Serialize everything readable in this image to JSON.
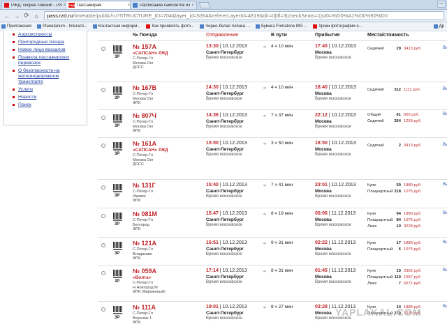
{
  "browser": {
    "tabs": [
      {
        "label": "РЖД: скорее совсем! - РЖД",
        "close": "×",
        "active": false
      },
      {
        "label": "Пассажирам",
        "close": "×",
        "active": true
      },
      {
        "label": "Расписание самолётов из С",
        "close": "×",
        "active": false
      }
    ],
    "win_button": "—",
    "url_domain": "pass.rzd.ru",
    "url_path": "/timetable/public/ru?STRUCTURE_ID=704&layer_id=5354&refererLayerId=4819&dir=0|tfl=3|checkSeats=1|st0=%D0%A1%D0%90%D0",
    "nav": {
      "back": "←",
      "forward": "→",
      "reload": "⟳",
      "home": "⌂"
    },
    "bookmarks": [
      {
        "label": "Приложения"
      },
      {
        "label": "Planetarium - Interacti..."
      },
      {
        "label": "Контактная информ..."
      },
      {
        "label": "Как проявлять фото..."
      },
      {
        "label": "Черно-белая плёнка ..."
      },
      {
        "label": "Бумага Fomatone MG ..."
      },
      {
        "label": "Уроки фотографии о..."
      }
    ],
    "bookmarks_other": "Др"
  },
  "sidebar": {
    "items": [
      "Аэроэкспрессы",
      "Пригородные поезда",
      "Новое лицо вокзалов",
      "Правила пассажирских перевозок",
      "О безопасности на железнодорожном транспорте",
      "Услуги",
      "Новости",
      "Поиск"
    ]
  },
  "table": {
    "headers": {
      "train": "№ Поезда",
      "departure": "Отправление",
      "duration": "В пути",
      "arrival": "Прибытие",
      "seats": "Места/стоимость"
    },
    "rows": [
      {
        "cls": "3Р",
        "num": "№ 157А",
        "brand": "«САПСАН»",
        "logo": "РЖД",
        "route": [
          "С-Петер-Гл",
          "Москва Окт"
        ],
        "company": "ДОСС",
        "dep_time": "13:30",
        "dep_date": "10.12.2013",
        "dep_station": "Санкт-Петербург",
        "dep_tz": "Время московское",
        "dur": "4 ч 10 мин",
        "arr_time": "17:40",
        "arr_date": "10.12.2013",
        "arr_station": "Москва",
        "arr_tz": "Время московское",
        "seats": [
          {
            "type": "Сидячий",
            "count": "29",
            "price": "3413 руб."
          }
        ]
      },
      {
        "cls": "3Р",
        "num": "№ 167В",
        "brand": "",
        "logo": "",
        "route": [
          "С-Петер-Гл",
          "Москва Окт"
        ],
        "company": "ФПК",
        "dep_time": "14:30",
        "dep_date": "10.12.2013",
        "dep_station": "Санкт-Петербург",
        "dep_tz": "Время московское",
        "dur": "4 ч 10 мин",
        "arr_time": "18:40",
        "arr_date": "10.12.2013",
        "arr_station": "Москва",
        "arr_tz": "Время московское",
        "seats": [
          {
            "type": "Сидячий",
            "count": "312",
            "price": "1111 руб."
          }
        ]
      },
      {
        "cls": "3Р",
        "num": "№ 807Ч",
        "brand": "",
        "logo": "",
        "route": [
          "С-Петер-Гл",
          "Москва Окт"
        ],
        "company": "ФПК",
        "dep_time": "14:36",
        "dep_date": "10.12.2013",
        "dep_station": "Санкт-Петербург",
        "dep_tz": "Время московское",
        "dur": "7 ч 37 мин",
        "arr_time": "22:12",
        "arr_date": "10.12.2013",
        "arr_station": "Москва",
        "arr_tz": "Время московское",
        "seats": [
          {
            "type": "Общий",
            "count": "61",
            "price": "603 руб."
          },
          {
            "type": "Сидячий",
            "count": "264",
            "price": "1259 руб."
          }
        ]
      },
      {
        "cls": "3Р",
        "num": "№ 161А",
        "brand": "«САПСАН»",
        "logo": "РЖД",
        "route": [
          "С-Петер-Гл",
          "Москва Окт"
        ],
        "company": "ДОСС",
        "dep_time": "15:00",
        "dep_date": "10.12.2013",
        "dep_station": "Санкт-Петербург",
        "dep_tz": "Время московское",
        "dur": "3 ч 50 мин",
        "arr_time": "18:50",
        "arr_date": "10.12.2013",
        "arr_station": "Москва",
        "arr_tz": "Время московское",
        "seats": [
          {
            "type": "Сидячий",
            "count": "2",
            "price": "3413 руб."
          }
        ]
      },
      {
        "cls": "3Р",
        "num": "№ 131Г",
        "brand": "",
        "logo": "",
        "route": [
          "С-Петер-Гл",
          "Ижевск"
        ],
        "company": "ФПК",
        "dep_time": "15:40",
        "dep_date": "10.12.2013",
        "dep_station": "Санкт-Петербург",
        "dep_tz": "Время московское",
        "dur": "7 ч 41 мин",
        "arr_time": "23:01",
        "arr_date": "10.12.2013",
        "arr_station": "Москва",
        "arr_tz": "Время московское",
        "seats": [
          {
            "type": "Купе",
            "count": "59",
            "price": "1880 руб."
          },
          {
            "type": "Плацкартный",
            "count": "218",
            "price": "1075 руб."
          }
        ]
      },
      {
        "cls": "3Р",
        "num": "№ 081М",
        "brand": "",
        "logo": "",
        "route": [
          "С-Петер-Гл",
          "Белгород"
        ],
        "company": "ФПК",
        "dep_time": "15:47",
        "dep_date": "10.12.2013",
        "dep_station": "Санкт-Петербург",
        "dep_tz": "Время московское",
        "dur": "8 ч 19 мин",
        "arr_time": "00:06",
        "arr_date": "11.12.2013",
        "arr_station": "Москва",
        "arr_tz": "Время московское",
        "seats": [
          {
            "type": "Купе",
            "count": "94",
            "price": "1880 руб."
          },
          {
            "type": "Плацкартный",
            "count": "84",
            "price": "1075 руб."
          },
          {
            "type": "Люкс",
            "count": "10",
            "price": "3228 руб."
          }
        ]
      },
      {
        "cls": "3Р",
        "num": "№ 121А",
        "brand": "",
        "logo": "",
        "route": [
          "С-Петер-Гл",
          "Владикавк"
        ],
        "company": "ФПК",
        "dep_time": "16:51",
        "dep_date": "10.12.2013",
        "dep_station": "Санкт-Петербург",
        "dep_tz": "Время московское",
        "dur": "9 ч 31 мин",
        "arr_time": "02:22",
        "arr_date": "11.12.2013",
        "arr_station": "Москва",
        "arr_tz": "Время московское",
        "seats": [
          {
            "type": "Купе",
            "count": "17",
            "price": "1880 руб."
          },
          {
            "type": "Плацкартный",
            "count": "6",
            "price": "1075 руб."
          }
        ]
      },
      {
        "cls": "3Р",
        "num": "№ 059А",
        "brand": "«Волга»",
        "logo": "",
        "route": [
          "С-Петер-Гл",
          "Н.Новгород М"
        ],
        "company": "ФПК (Фирменный)",
        "dep_time": "17:14",
        "dep_date": "10.12.2013",
        "dep_station": "Санкт-Петербург",
        "dep_tz": "Время московское",
        "dur": "8 ч 31 мин",
        "arr_time": "01:45",
        "arr_date": "11.12.2013",
        "arr_station": "Москва",
        "arr_tz": "Время московское",
        "seats": [
          {
            "type": "Купе",
            "count": "19",
            "price": "2362 руб."
          },
          {
            "type": "Плацкартный",
            "count": "119",
            "price": "1557 руб."
          },
          {
            "type": "Люкс",
            "count": "7",
            "price": "6571 руб."
          }
        ]
      },
      {
        "cls": "3Р",
        "num": "№ 111А",
        "brand": "",
        "logo": "",
        "route": [
          "С-Петер-Гл",
          "Воронеж 1"
        ],
        "company": "ФПК",
        "dep_time": "19:01",
        "dep_date": "10.12.2013",
        "dep_station": "Санкт-Петербург",
        "dep_tz": "Время московское",
        "dur": "8 ч 27 мин",
        "arr_time": "03:28",
        "arr_date": "11.12.2013",
        "arr_station": "Москва",
        "arr_tz": "Время московское",
        "seats": [
          {
            "type": "Купе",
            "count": "14",
            "price": "1880 руб."
          },
          {
            "type": "Плацкартный",
            "count": "270",
            "price": "1075 руб."
          }
        ]
      }
    ],
    "buy_label": "Вы"
  },
  "watermark": "YAPLAKAL.COM"
}
